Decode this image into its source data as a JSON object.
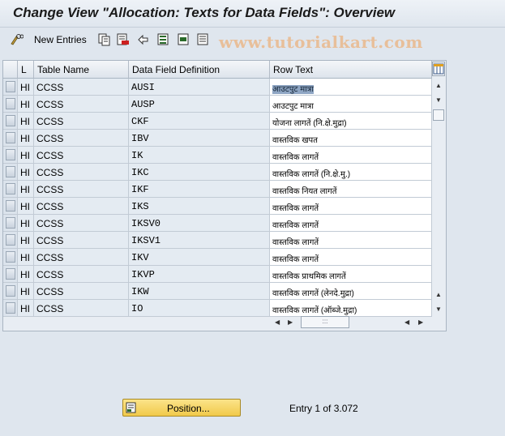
{
  "title": "Change View \"Allocation: Texts for Data Fields\": Overview",
  "toolbar": {
    "new_entries_label": "New Entries",
    "icons": [
      "edit-glasses-icon",
      "copy-icon",
      "delete-icon",
      "undo-icon",
      "select-all-icon",
      "select-block-icon",
      "deselect-all-icon"
    ]
  },
  "watermark": "www.tutorialkart.com",
  "table": {
    "headers": {
      "lang": "L",
      "table_name": "Table Name",
      "field_def": "Data Field Definition",
      "row_text": "Row Text"
    },
    "rows": [
      {
        "lang": "HI",
        "table": "CCSS",
        "field": "AUSI",
        "text": "आउटपुट मात्रा"
      },
      {
        "lang": "HI",
        "table": "CCSS",
        "field": "AUSP",
        "text": "आउटपुट मात्रा"
      },
      {
        "lang": "HI",
        "table": "CCSS",
        "field": "CKF",
        "text": "योजना लागतें (नि.क्षे.मुद्रा)"
      },
      {
        "lang": "HI",
        "table": "CCSS",
        "field": "IBV",
        "text": "वास्तविक खपत"
      },
      {
        "lang": "HI",
        "table": "CCSS",
        "field": "IK",
        "text": "वास्तविक लागतें"
      },
      {
        "lang": "HI",
        "table": "CCSS",
        "field": "IKC",
        "text": "वास्तविक लागतें (नि.क्षे.मु.)"
      },
      {
        "lang": "HI",
        "table": "CCSS",
        "field": "IKF",
        "text": "वास्तविक नियत लागतें"
      },
      {
        "lang": "HI",
        "table": "CCSS",
        "field": "IKS",
        "text": "वास्तविक लागतें"
      },
      {
        "lang": "HI",
        "table": "CCSS",
        "field": "IKSV0",
        "text": "वास्तविक लागतें"
      },
      {
        "lang": "HI",
        "table": "CCSS",
        "field": "IKSV1",
        "text": "वास्तविक लागतें"
      },
      {
        "lang": "HI",
        "table": "CCSS",
        "field": "IKV",
        "text": "वास्तविक लागतें"
      },
      {
        "lang": "HI",
        "table": "CCSS",
        "field": "IKVP",
        "text": "वास्तविक प्राथमिक लागतें"
      },
      {
        "lang": "HI",
        "table": "CCSS",
        "field": "IKW",
        "text": "वास्तविक लागतें (लेनदे.मुद्रा)"
      },
      {
        "lang": "HI",
        "table": "CCSS",
        "field": "IO",
        "text": "वास्तविक लागतें (ऑब्जे.मुद्रा)"
      }
    ]
  },
  "scroll_thumb_label": ":::",
  "position_button_label": "Position...",
  "entry_info": "Entry 1 of 3.072",
  "colors": {
    "background": "#dfe6ee",
    "button": "#f1c94a",
    "selected_text": "#8fa6c4"
  }
}
